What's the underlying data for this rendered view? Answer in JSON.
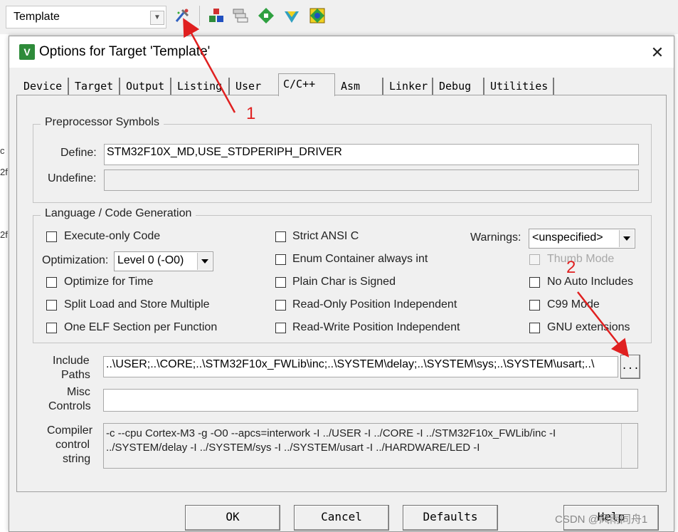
{
  "toolbar": {
    "target_select": "Template",
    "icons": [
      "target-options-icon",
      "manage-components-icon",
      "select-packs-icon",
      "pack-installer-icon",
      "run-time-env-icon",
      "software-packs-icon"
    ]
  },
  "background": {
    "left_fragments": [
      "c",
      "2f",
      "2f"
    ]
  },
  "dialog": {
    "title": "Options for Target 'Template'",
    "close": "✕",
    "tabs": [
      "Device",
      "Target",
      "Output",
      "Listing",
      "User",
      "C/C++",
      "Asm",
      "Linker",
      "Debug",
      "Utilities"
    ],
    "active_tab": "C/C++",
    "preprocessor": {
      "legend": "Preprocessor Symbols",
      "define_label": "Define:",
      "define_value": "STM32F10X_MD,USE_STDPERIPH_DRIVER",
      "undefine_label": "Undefine:",
      "undefine_value": ""
    },
    "language": {
      "legend": "Language / Code Generation",
      "execute_only": "Execute-only Code",
      "optimization_label": "Optimization:",
      "optimization_value": "Level 0 (-O0)",
      "optimize_time": "Optimize for Time",
      "split_load": "Split Load and Store Multiple",
      "one_elf": "One ELF Section per Function",
      "strict_ansi": "Strict ANSI C",
      "enum_container": "Enum Container always int",
      "plain_char": "Plain Char is Signed",
      "ro_pos": "Read-Only Position Independent",
      "rw_pos": "Read-Write Position Independent",
      "warnings_label": "Warnings:",
      "warnings_value": "<unspecified>",
      "thumb_mode": "Thumb Mode",
      "no_auto_includes": "No Auto Includes",
      "c99_mode": "C99 Mode",
      "gnu_ext": "GNU extensions"
    },
    "include_paths_label_1": "Include",
    "include_paths_label_2": "Paths",
    "include_paths_value": "..\\USER;..\\CORE;..\\STM32F10x_FWLib\\inc;..\\SYSTEM\\delay;..\\SYSTEM\\sys;..\\SYSTEM\\usart;..\\",
    "browse_button": "...",
    "misc_label_1": "Misc",
    "misc_label_2": "Controls",
    "misc_value": "",
    "compiler_label_1": "Compiler",
    "compiler_label_2": "control",
    "compiler_label_3": "string",
    "compiler_line_1": "-c --cpu Cortex-M3 -g -O0 --apcs=interwork -I ../USER -I ../CORE -I ../STM32F10x_FWLib/inc -I",
    "compiler_line_2": "../SYSTEM/delay -I ../SYSTEM/sys -I ../SYSTEM/usart -I ../HARDWARE/LED -I",
    "buttons": {
      "ok": "OK",
      "cancel": "Cancel",
      "defaults": "Defaults",
      "help": "Help"
    }
  },
  "annotations": {
    "arrow_1": "1",
    "arrow_2": "2",
    "color": "#e02020"
  },
  "watermark": "CSDN @风雨同舟1"
}
